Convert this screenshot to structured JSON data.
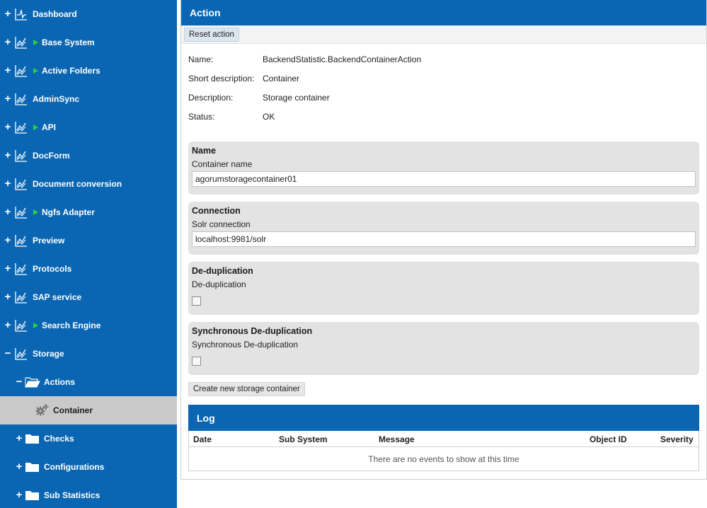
{
  "sidebar": {
    "items": [
      {
        "label": "Dashboard",
        "toggle": "+",
        "icon": "dashboard-icon",
        "arrow": false
      },
      {
        "label": "Base System",
        "toggle": "+",
        "icon": "chart-icon",
        "arrow": true
      },
      {
        "label": "Active Folders",
        "toggle": "+",
        "icon": "chart-icon",
        "arrow": true
      },
      {
        "label": "AdminSync",
        "toggle": "+",
        "icon": "chart-icon",
        "arrow": false
      },
      {
        "label": "API",
        "toggle": "+",
        "icon": "chart-icon",
        "arrow": true
      },
      {
        "label": "DocForm",
        "toggle": "+",
        "icon": "chart-icon",
        "arrow": false
      },
      {
        "label": "Document conversion",
        "toggle": "+",
        "icon": "chart-icon",
        "arrow": false
      },
      {
        "label": "Ngfs Adapter",
        "toggle": "+",
        "icon": "chart-icon",
        "arrow": true
      },
      {
        "label": "Preview",
        "toggle": "+",
        "icon": "chart-icon",
        "arrow": false
      },
      {
        "label": "Protocols",
        "toggle": "+",
        "icon": "chart-icon",
        "arrow": false
      },
      {
        "label": "SAP service",
        "toggle": "+",
        "icon": "chart-icon",
        "arrow": false
      },
      {
        "label": "Search Engine",
        "toggle": "+",
        "icon": "chart-icon",
        "arrow": true
      },
      {
        "label": "Storage",
        "toggle": "−",
        "icon": "chart-icon",
        "arrow": false
      },
      {
        "label": "Actions",
        "toggle": "−",
        "icon": "open-folder-icon",
        "arrow": false
      },
      {
        "label": "Container",
        "toggle": "",
        "icon": "gears-icon",
        "arrow": false,
        "selected": true
      },
      {
        "label": "Checks",
        "toggle": "+",
        "icon": "folder-icon",
        "arrow": false
      },
      {
        "label": "Configurations",
        "toggle": "+",
        "icon": "folder-icon",
        "arrow": false
      },
      {
        "label": "Sub Statistics",
        "toggle": "+",
        "icon": "folder-icon",
        "arrow": false
      }
    ]
  },
  "main": {
    "title": "Action",
    "reset_label": "Reset action",
    "info": [
      {
        "key": "Name:",
        "value": "BackendStatistic.BackendContainerAction"
      },
      {
        "key": "Short description:",
        "value": "Container"
      },
      {
        "key": "Description:",
        "value": "Storage container"
      },
      {
        "key": "Status:",
        "value": "OK"
      }
    ],
    "sections": {
      "name": {
        "title": "Name",
        "label": "Container name",
        "value": "agorumstoragecontainer01"
      },
      "connection": {
        "title": "Connection",
        "label": "Solr connection",
        "value": "localhost:9981/solr"
      },
      "dedup": {
        "title": "De-duplication",
        "label": "De-duplication",
        "checked": false
      },
      "sync_dedup": {
        "title": "Synchronous De-duplication",
        "label": "Synchronous De-duplication",
        "checked": false
      }
    },
    "create_label": "Create new storage container",
    "log": {
      "title": "Log",
      "columns": [
        "Date",
        "Sub System",
        "Message",
        "Object ID",
        "Severity"
      ],
      "empty_text": "There are no events to show at this time"
    }
  },
  "colors": {
    "brand_blue": "#0a66b2",
    "selected_bg": "#c9c9c9",
    "arrow_green": "#29d13a"
  }
}
